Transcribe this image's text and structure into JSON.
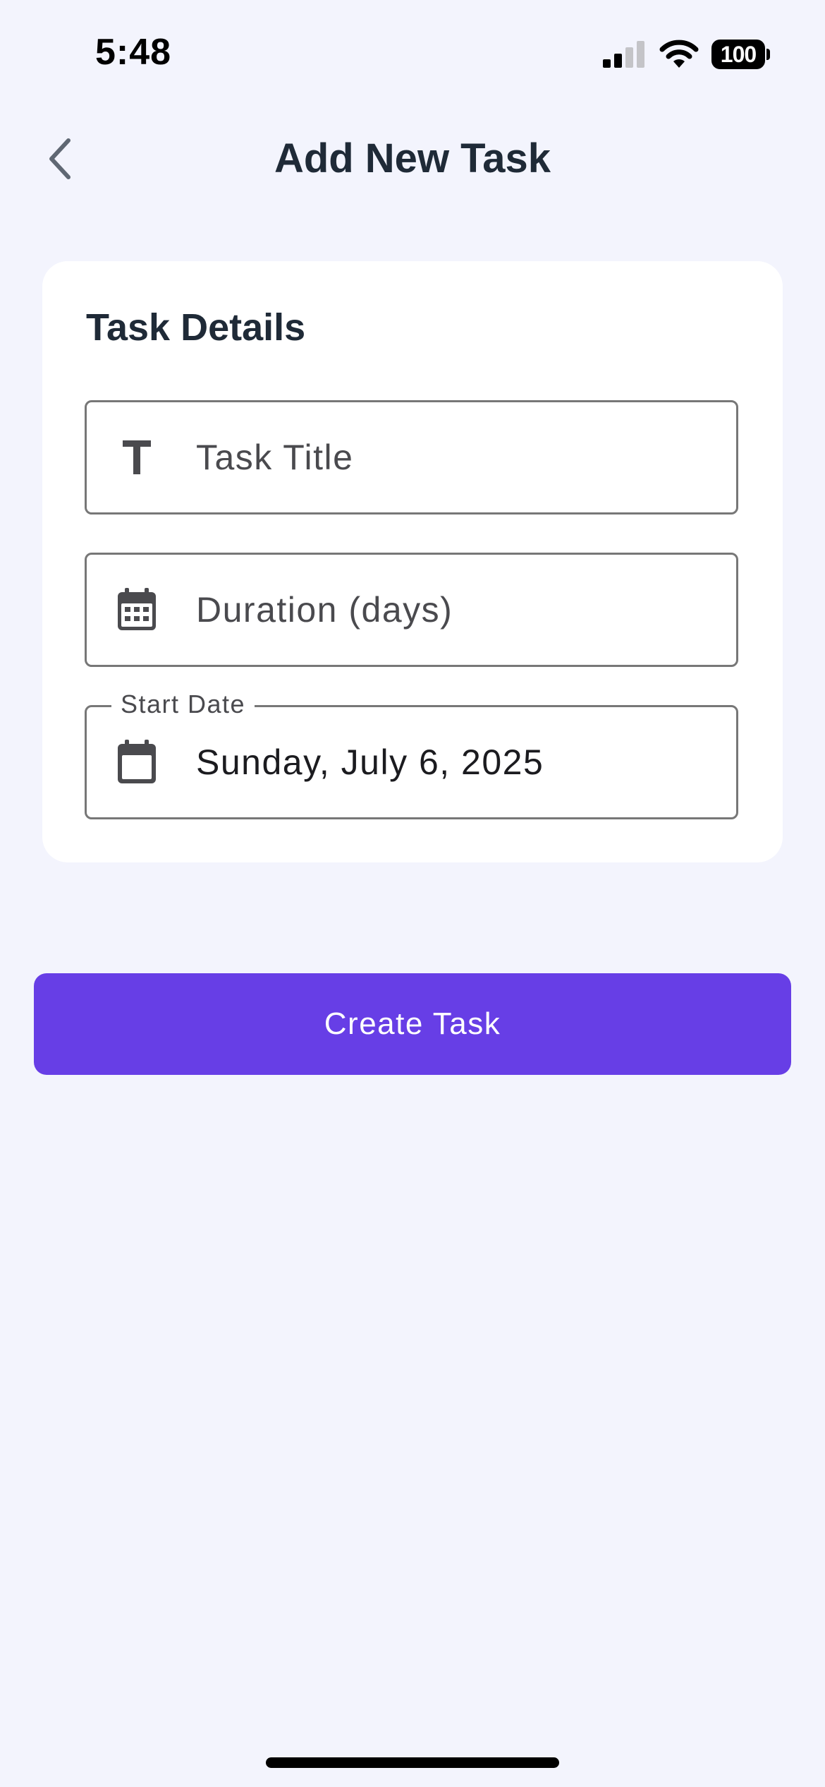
{
  "status_bar": {
    "time": "5:48",
    "battery_level": "100",
    "icons": [
      "signal-icon",
      "wifi-icon",
      "battery-icon"
    ]
  },
  "header": {
    "title": "Add New Task",
    "back_icon": "chevron-left-icon"
  },
  "card": {
    "title": "Task Details",
    "fields": {
      "title": {
        "icon": "text-t-icon",
        "placeholder": "Task Title",
        "value": ""
      },
      "duration": {
        "icon": "calendar-grid-icon",
        "placeholder": "Duration (days)",
        "value": ""
      },
      "start_date": {
        "icon": "calendar-icon",
        "label": "Start Date",
        "value": "Sunday, July 6, 2025"
      }
    }
  },
  "actions": {
    "create_label": "Create Task"
  },
  "colors": {
    "background": "#f3f4fd",
    "card": "#ffffff",
    "primary": "#673ee6",
    "title_text": "#1f2a37",
    "field_border": "#777777",
    "icon": "#4a4a4e"
  }
}
